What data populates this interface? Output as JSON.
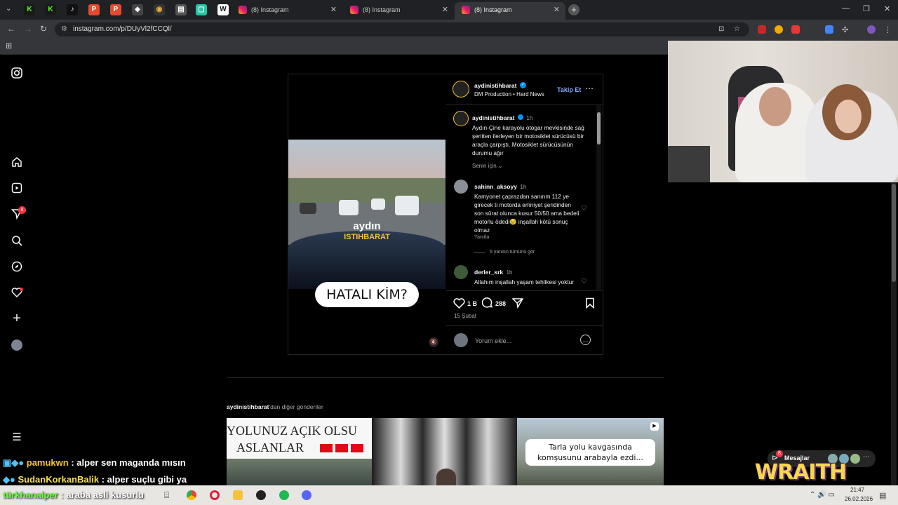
{
  "browser": {
    "tabs": [
      {
        "title": "(8) Instagram",
        "active": false
      },
      {
        "title": "(8) Instagram",
        "active": false
      },
      {
        "title": "(8) Instagram",
        "active": true
      }
    ],
    "url": "instagram.com/p/DUyVl2fCCQl/"
  },
  "post": {
    "account": "aydinistihbarat",
    "subtitle_left": "DM Production",
    "subtitle_right": "Hard News",
    "follow_label": "Takip Et",
    "video_brand_top": "aydın",
    "video_brand_bottom": "ISTIHBARAT",
    "video_caption": "HATALI KİM?",
    "caption_user": "aydinistihbarat",
    "caption_time": "1h",
    "caption_text": "Aydın-Çine karayolu otogar mevkisinde sağ şeritten ilerleyen bir motosiklet sürücüsü bir araçla çarpıştı. Motosiklet sürücüsünün durumu ağır",
    "translation_label": "Senin için",
    "comments": [
      {
        "user": "sahinn_aksoyy",
        "time": "1h",
        "text": "Kamyonet çaprazdan sanırım 112 ye girecek ti motorda emniyet şeridinden son sürat olunca kusur 50/50 ama bedeli motorlu ödedi😢 inşallah kötü sonuç olmaz",
        "reply_label": "Yanıtla",
        "view_replies": "6 yanıtın tümünü gör"
      },
      {
        "user": "derler_srk",
        "time": "1h",
        "text": "Allahım inşallah yaşam tehlikesi yoktur"
      }
    ],
    "likes": "1 B",
    "comments_count": "288",
    "date": "15 Şubat",
    "comment_placeholder": "Yorum ekle..."
  },
  "more_posts": {
    "header_user": "aydinistihbarat",
    "header_suffix": "'dan diğer gönderiler",
    "thumb1_line1": "YOLUNUZ AÇIK OLSU",
    "thumb1_line2": "ASLANLAR",
    "thumb3_text": "Tarla yolu kavgasında komşusunu arabayla ezdi..."
  },
  "sidebar": {
    "notification_badge": "8"
  },
  "chat": [
    {
      "user": "pamukwn",
      "message": ": alper sen maganda mısın"
    },
    {
      "user": "SudanKorkanBalik",
      "message": ": alper suçlu gibi ya"
    },
    {
      "user": "türkhanalper",
      "message": ": araba asli kusurlu"
    }
  ],
  "overlay": {
    "messages_label": "Mesajlar",
    "messages_badge": "8",
    "brand": "WRAITH"
  },
  "taskbar": {
    "time": "21:47",
    "date": "26.02.2026"
  }
}
